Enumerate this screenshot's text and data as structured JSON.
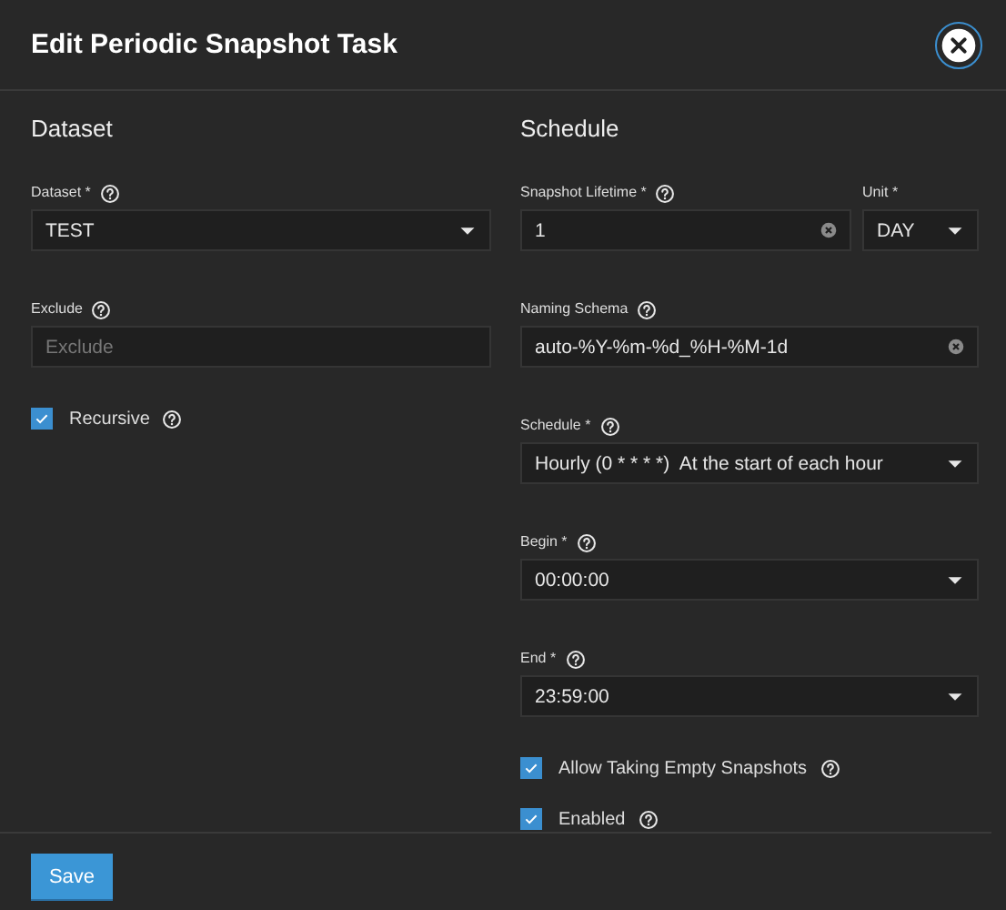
{
  "dialog": {
    "title": "Edit Periodic Snapshot Task"
  },
  "columns": [
    {
      "heading": "Dataset",
      "fields": [
        {
          "kind": "select",
          "label": "Dataset *",
          "help": true,
          "value": "TEST"
        },
        {
          "kind": "text",
          "label": "Exclude",
          "help": true,
          "placeholder": "Exclude"
        },
        {
          "kind": "checkbox",
          "label": "Recursive",
          "help": true,
          "checked": true
        }
      ]
    },
    {
      "heading": "Schedule",
      "fields": [
        {
          "kind": "pair",
          "items": [
            {
              "kind": "text",
              "label": "Snapshot Lifetime *",
              "help": true,
              "value": "1",
              "clearable": true
            },
            {
              "kind": "select",
              "label": "Unit *",
              "help": false,
              "value": "DAY"
            }
          ]
        },
        {
          "kind": "text",
          "label": "Naming Schema",
          "help": true,
          "value": "auto-%Y-%m-%d_%H-%M-1d",
          "clearable": true
        },
        {
          "kind": "select",
          "label": "Schedule *",
          "help": true,
          "value": "Hourly (0 * * * *)  At the start of each hour"
        },
        {
          "kind": "select",
          "label": "Begin *",
          "help": true,
          "value": "00:00:00"
        },
        {
          "kind": "select",
          "label": "End *",
          "help": true,
          "value": "23:59:00"
        },
        {
          "kind": "checkbox",
          "label": "Allow Taking Empty Snapshots",
          "help": true,
          "checked": true
        },
        {
          "kind": "checkbox",
          "label": "Enabled",
          "help": true,
          "checked": true
        }
      ]
    }
  ],
  "buttons": [
    {
      "label": "Save"
    }
  ]
}
